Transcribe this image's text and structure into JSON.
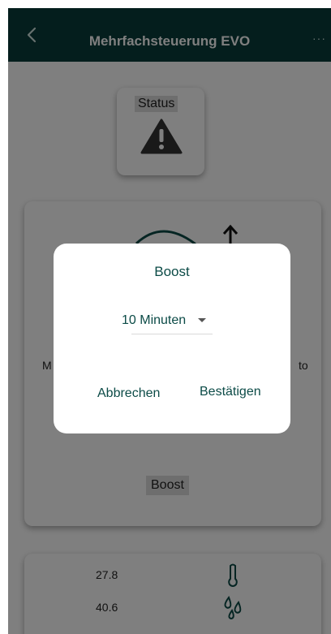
{
  "header": {
    "title": "Mehrfachsteuerung EVO",
    "back_icon": "chevron-left-icon",
    "more_label": "···"
  },
  "status": {
    "label": "Status",
    "icon": "warning-icon"
  },
  "control": {
    "left_label": "M",
    "right_label": "to",
    "boost_label": "Boost",
    "arrow_icon": "arrow-up-icon"
  },
  "sensors": {
    "temperature": "27.8",
    "humidity": "40.6",
    "temperature_icon": "thermometer-icon",
    "humidity_icon": "water-drops-icon"
  },
  "dialog": {
    "title": "Boost",
    "selected_option": "10 Minuten",
    "cancel_label": "Abbrechen",
    "confirm_label": "Bestätigen"
  },
  "colors": {
    "header_bg": "#083d3a",
    "accent_text": "#0c4b47",
    "overlay": "rgba(0,0,0,0.5)"
  }
}
